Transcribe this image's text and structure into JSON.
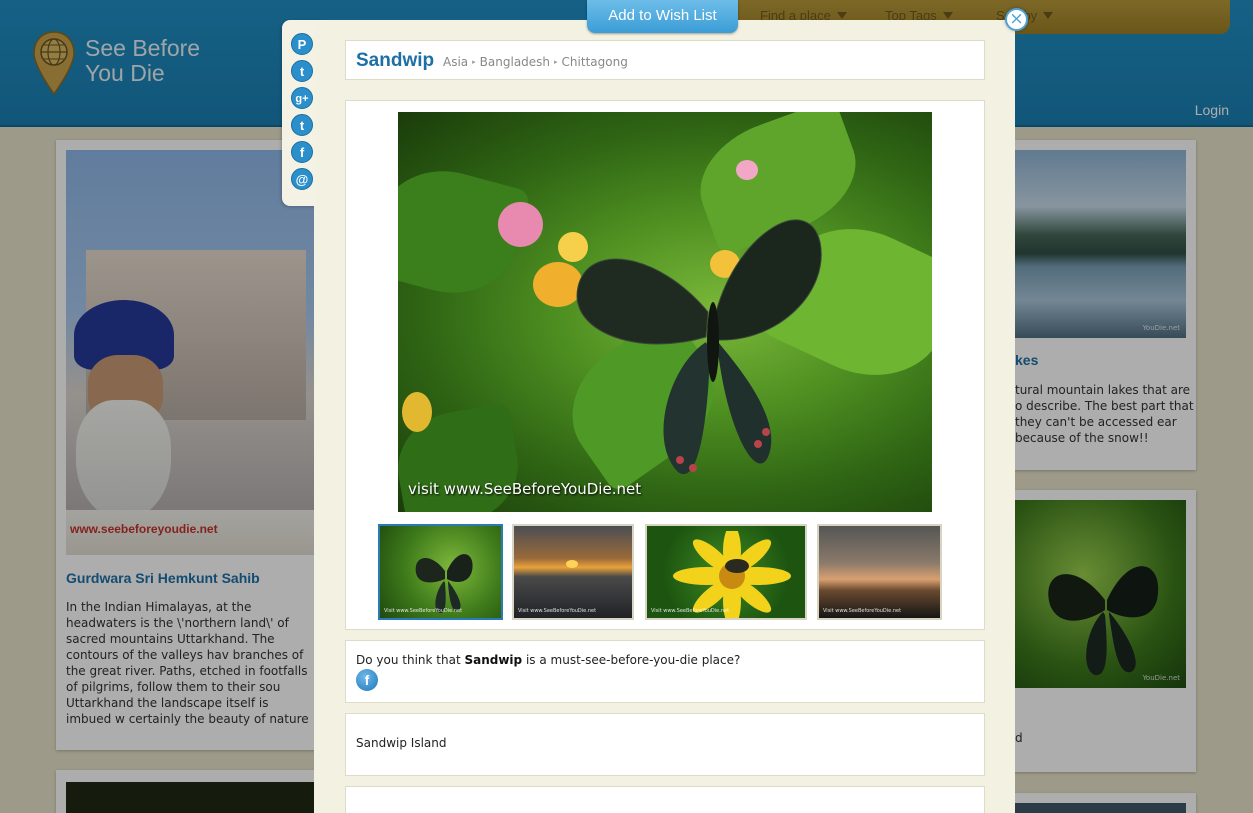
{
  "site": {
    "logo_text": "See Before You Die",
    "nav": [
      {
        "label": "Find a place"
      },
      {
        "label": "Top Tags"
      },
      {
        "label": "Sort by"
      }
    ],
    "login_label": "Login"
  },
  "background_cards": {
    "left": {
      "banner_text": "www.seebeforeyoudie.net",
      "title": "Gurdwara Sri Hemkunt Sahib",
      "text": "In the Indian Himalayas, at the headwaters is the \\'northern land\\' of sacred mountains Uttarkhand. The contours of the valleys hav branches of the great river. Paths, etched in footfalls of pilgrims, follow them to their sou Uttarkhand the landscape itself is imbued w certainly the beauty of nature is interwoven pilgrimage."
    },
    "right_top": {
      "title": "kes",
      "text": "tural mountain lakes that are o describe. The best part that they can't be accessed ear because of the snow!!",
      "watermark": "YouDie.net"
    },
    "right_bottom": {
      "watermark": "YouDie.net",
      "text": "d"
    }
  },
  "modal": {
    "wish_list_label": "Add to Wish List",
    "close_symbol": "×",
    "share_icons": [
      {
        "name": "pinterest-icon",
        "glyph": "P"
      },
      {
        "name": "tumblr-icon",
        "glyph": "t"
      },
      {
        "name": "google-plus-icon",
        "glyph": "g+"
      },
      {
        "name": "twitter-icon",
        "glyph": "t"
      },
      {
        "name": "facebook-icon",
        "glyph": "f"
      },
      {
        "name": "email-icon",
        "glyph": "@"
      }
    ],
    "place_name": "Sandwip",
    "breadcrumb": [
      "Asia",
      "Bangladesh",
      "Chittagong"
    ],
    "breadcrumb_sep": "▸",
    "main_photo_watermark": "visit www.SeeBeforeYouDie.net",
    "thumbnails": [
      {
        "name": "butterfly",
        "active": true,
        "watermark": "Visit www.SeeBeforeYouDie.net"
      },
      {
        "name": "sunset-sea",
        "active": false,
        "watermark": "Visit www.SeeBeforeYouDie.net"
      },
      {
        "name": "yellow-flower",
        "active": false,
        "watermark": "Visit www.SeeBeforeYouDie.net"
      },
      {
        "name": "grass-sunset",
        "active": false,
        "watermark": "Visit www.SeeBeforeYouDie.net"
      }
    ],
    "question_prefix": "Do you think that ",
    "question_suffix": " is a must-see-before-you-die place?",
    "facebook_glyph": "f",
    "description": "Sandwip Island"
  },
  "colors": {
    "header_blue": "#1f8fc4",
    "nav_gold": "#b89a3a",
    "title_blue": "#1e6fa5",
    "modal_bg": "#f3f1e1",
    "wish_button": "#3a9dd6"
  }
}
